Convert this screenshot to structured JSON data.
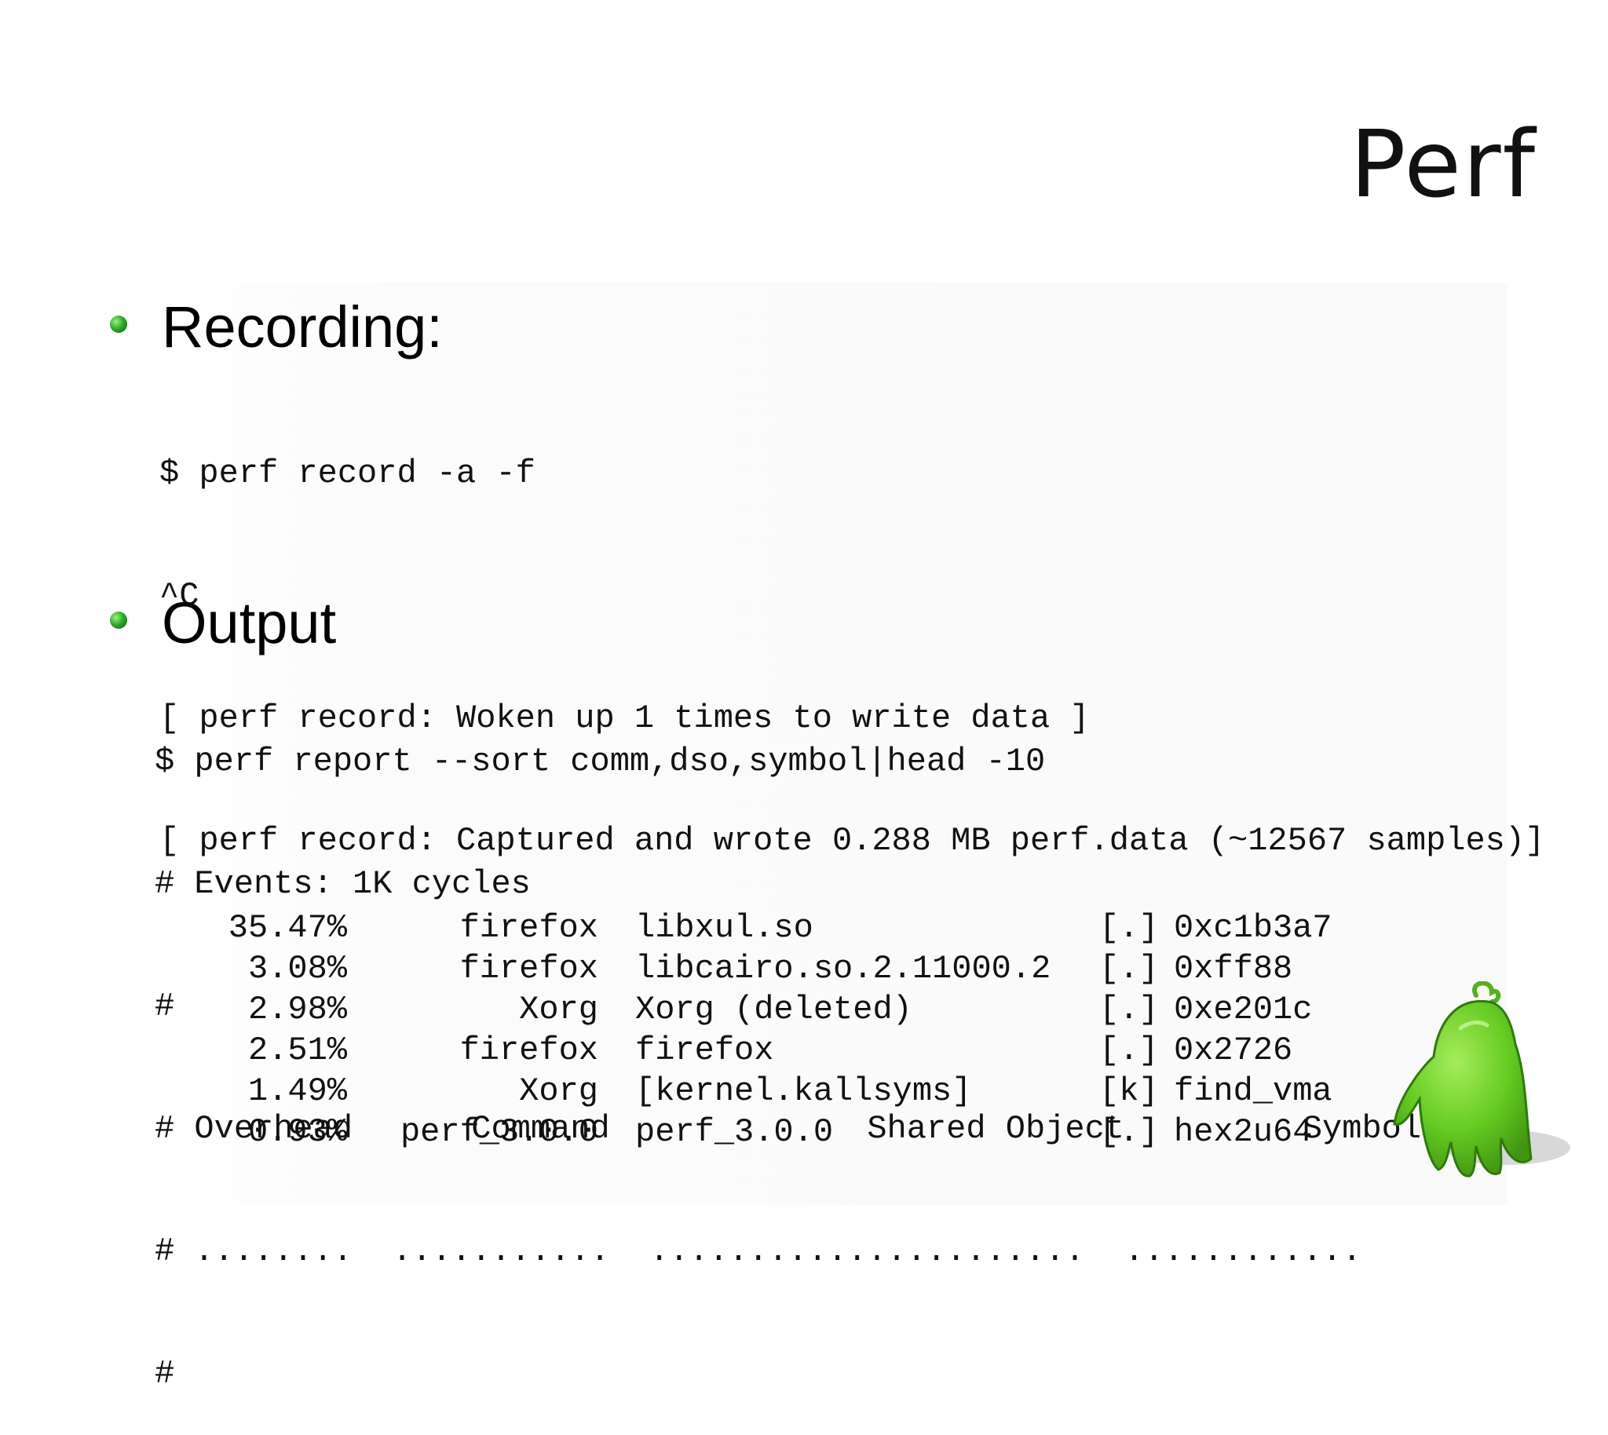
{
  "slide": {
    "title": "Perf",
    "sections": [
      {
        "heading": "Recording:",
        "lines": [
          "$ perf record -a -f",
          "^C",
          "[ perf record: Woken up 1 times to write data ]",
          "[ perf record: Captured and wrote 0.288 MB perf.data (~12567 samples)]"
        ]
      },
      {
        "heading": "Output",
        "lines": [
          "$ perf report --sort comm,dso,symbol|head -10",
          "# Events: 1K cycles",
          "#",
          "# Overhead      Command             Shared Object         Symbol",
          "# ........  ...........  ......................  ............",
          "#"
        ]
      }
    ],
    "report_rows": [
      {
        "overhead": "35.47%",
        "command": "firefox",
        "object": "libxul.so",
        "level": "[.]",
        "symbol": "0xc1b3a7"
      },
      {
        "overhead": "3.08%",
        "command": "firefox",
        "object": "libcairo.so.2.11000.2",
        "level": "[.]",
        "symbol": "0xff88"
      },
      {
        "overhead": "2.98%",
        "command": "Xorg",
        "object": "Xorg (deleted)",
        "level": "[.]",
        "symbol": "0xe201c"
      },
      {
        "overhead": "2.51%",
        "command": "firefox",
        "object": "firefox",
        "level": "[.]",
        "symbol": "0x2726"
      },
      {
        "overhead": "1.49%",
        "command": "Xorg",
        "object": "[kernel.kallsyms]",
        "level": "[k]",
        "symbol": "find_vma"
      },
      {
        "overhead": "0.93%",
        "command": "perf_3.0.0",
        "object": "perf_3.0.0",
        "level": "[.]",
        "symbol": "hex2u64"
      }
    ],
    "icons": [
      "bullet-icon",
      "mascot-icon"
    ],
    "colors": {
      "bullet": "#2fae2a",
      "mascot": "#66cc22"
    }
  }
}
